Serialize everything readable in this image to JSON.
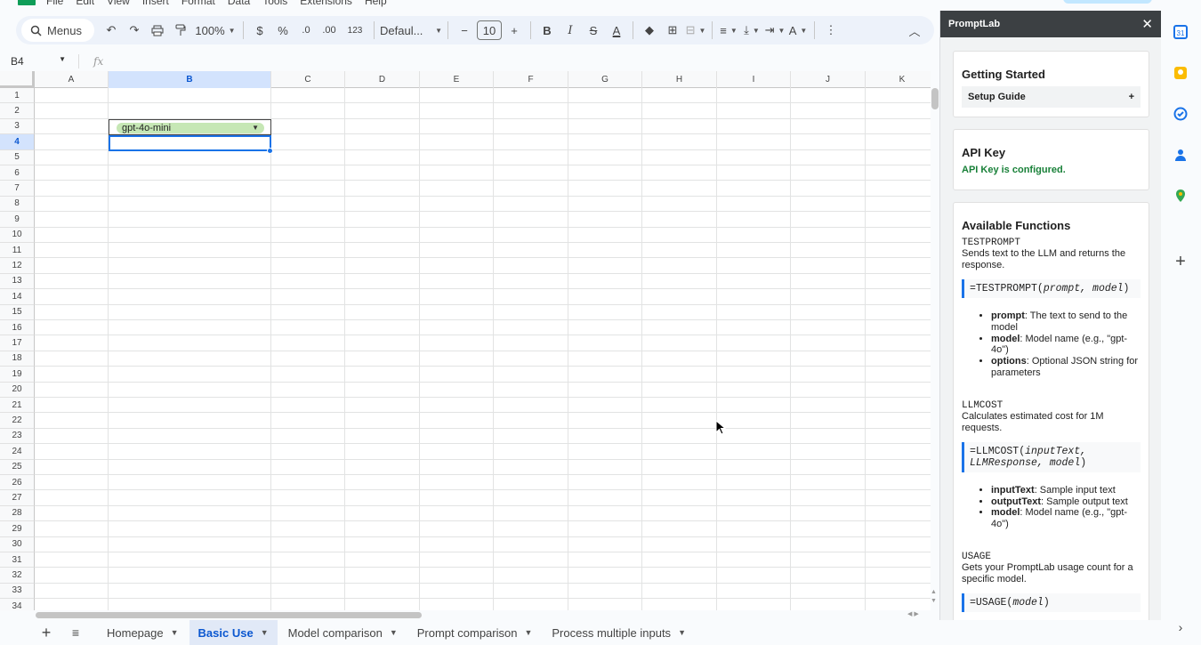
{
  "menubar": {
    "items": [
      "File",
      "Edit",
      "View",
      "Insert",
      "Format",
      "Data",
      "Tools",
      "Extensions",
      "Help"
    ]
  },
  "toolbar": {
    "menus_label": "Menus",
    "zoom": "100%",
    "currency": "$",
    "percent": "%",
    "dec_decrease": ".0",
    "dec_increase": ".00",
    "number_format": "123",
    "font": "Defaul...",
    "font_size": "10",
    "bold": "B",
    "italic": "I",
    "strike": "S",
    "textcolor": "A"
  },
  "formula_bar": {
    "cell_ref": "B4",
    "fx": "fx",
    "value": ""
  },
  "grid": {
    "columns": [
      "A",
      "B",
      "C",
      "D",
      "E",
      "F",
      "G",
      "H",
      "I",
      "J",
      "K"
    ],
    "rows": [
      "1",
      "2",
      "3",
      "4",
      "5",
      "6",
      "7",
      "8",
      "9",
      "10",
      "11",
      "12",
      "13",
      "14",
      "15",
      "16",
      "17",
      "18",
      "19",
      "20",
      "21",
      "22",
      "23",
      "24",
      "25",
      "26",
      "27",
      "28",
      "29",
      "30",
      "31",
      "32",
      "33",
      "34"
    ],
    "selected_column": "B",
    "selected_row": "4",
    "cell_b3": "gpt-4o-mini"
  },
  "sheets": {
    "tabs": [
      "Homepage",
      "Basic Use",
      "Model comparison",
      "Prompt comparison",
      "Process multiple inputs"
    ],
    "active": "Basic Use"
  },
  "panel": {
    "title": "PromptLab",
    "getting_started": {
      "heading": "Getting Started",
      "setup_label": "Setup Guide",
      "setup_toggle": "+"
    },
    "api_key": {
      "heading": "API Key",
      "status": "API Key is configured."
    },
    "functions": {
      "heading": "Available Functions",
      "testprompt": {
        "name": "TESTPROMPT",
        "desc": "Sends text to the LLM and returns the response.",
        "code_fn": "=TESTPROMPT(",
        "code_args": "prompt, model",
        "code_end": ")",
        "params": [
          {
            "name": "prompt",
            "desc": ": The text to send to the model"
          },
          {
            "name": "model",
            "desc": ": Model name (e.g., \"gpt-4o\")"
          },
          {
            "name": "options",
            "desc": ": Optional JSON string for parameters"
          }
        ]
      },
      "llmcost": {
        "name": "LLMCOST",
        "desc": "Calculates estimated cost for 1M requests.",
        "code_fn": "=LLMCOST(",
        "code_args1": "inputText,",
        "code_args2": "LLMResponse, model",
        "code_end": ")",
        "params": [
          {
            "name": "inputText",
            "desc": ": Sample input text"
          },
          {
            "name": "outputText",
            "desc": ": Sample output text"
          },
          {
            "name": "model",
            "desc": ": Model name (e.g., \"gpt-4o\")"
          }
        ]
      },
      "usage": {
        "name": "USAGE",
        "desc": "Gets your PromptLab usage count for a specific model.",
        "code_fn": "=USAGE(",
        "code_args": "model",
        "code_end": ")"
      }
    }
  },
  "colors": {
    "accent": "#1a73e8",
    "chip": "#c6e7b5",
    "panel_header": "#3c4043",
    "status_ok": "#188038"
  }
}
